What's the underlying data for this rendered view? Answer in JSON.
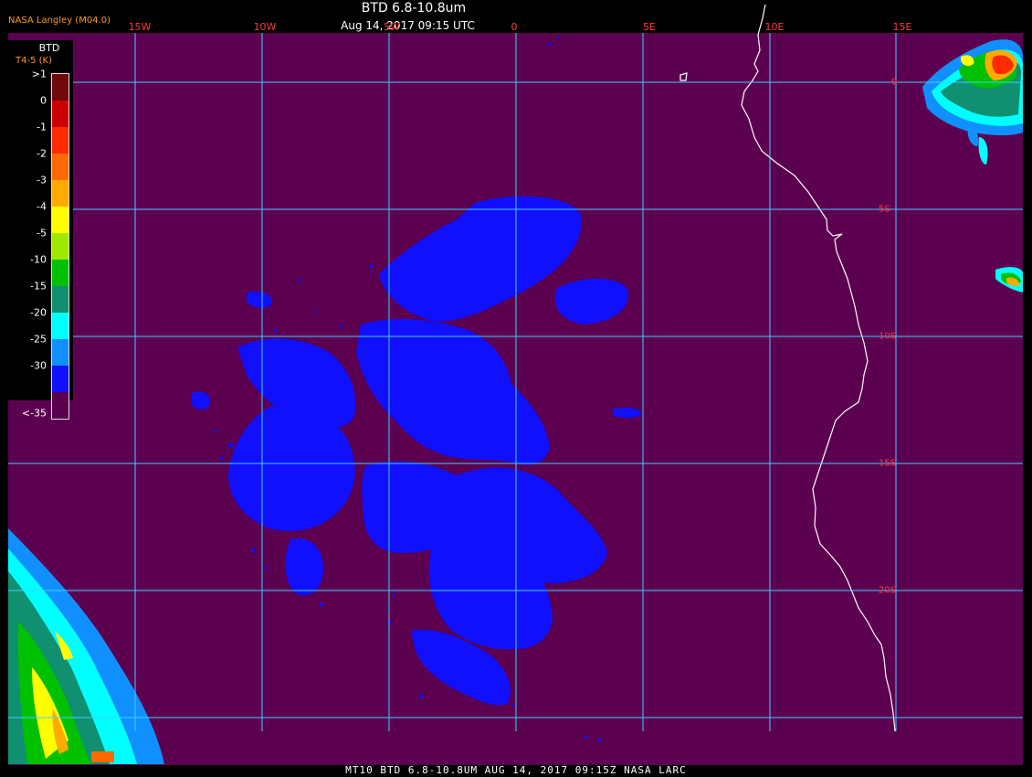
{
  "header": {
    "source": "NASA Langley (M04.0)",
    "title": "BTD 6.8-10.8um",
    "date": "Aug 14, 2017 09:15 UTC"
  },
  "footer": {
    "text": "MT10  BTD 6.8-10.8UM  AUG 14, 2017 09:15Z  NASA LARC"
  },
  "grid": {
    "longitudes": [
      "15W",
      "10W",
      "5W",
      "0",
      "5E",
      "10E",
      "15E"
    ],
    "latitudes": [
      "0",
      "5S",
      "10S",
      "15S",
      "20S"
    ]
  },
  "legend": {
    "title": "BTD",
    "units": "T4-5 (K)",
    "labels": [
      ">1",
      "0",
      "-1",
      "-2",
      "-3",
      "-4",
      "-5",
      "-10",
      "-15",
      "-20",
      "-25",
      "-30",
      "<-35"
    ],
    "colors": [
      "#6e0a0a",
      "#cc0000",
      "#ff2a00",
      "#ff6a00",
      "#ffaa00",
      "#ffff00",
      "#a0e800",
      "#00c000",
      "#109070",
      "#00ffff",
      "#1090ff",
      "#1010ff",
      "#5c0050"
    ]
  },
  "colors": {
    "background": "#5c0050",
    "grid": "#40d0ff",
    "coast": "#ffffff",
    "cloud": "#1010ff"
  }
}
